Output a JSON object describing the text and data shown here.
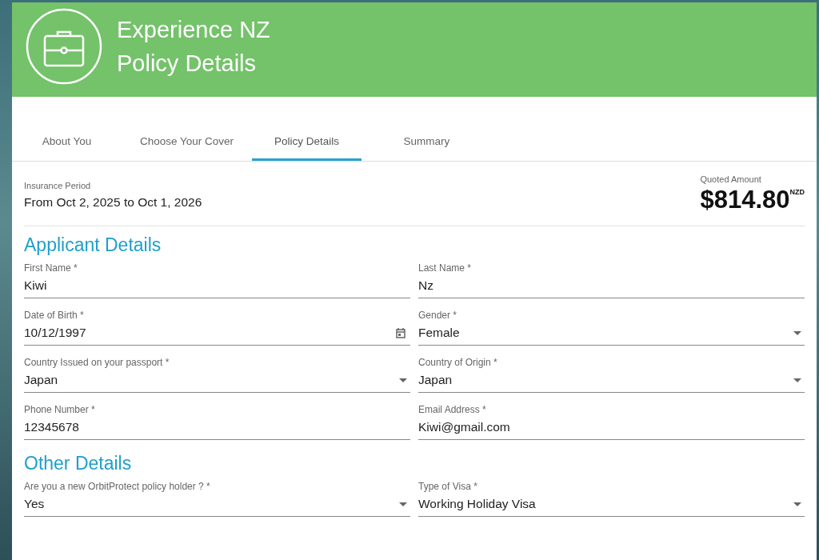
{
  "header": {
    "title_lines": [
      "Experience NZ",
      "Policy Details"
    ]
  },
  "tabs": [
    {
      "label": "About You",
      "selected": false
    },
    {
      "label": "Choose Your Cover",
      "selected": false
    },
    {
      "label": "Policy Details",
      "selected": true
    },
    {
      "label": "Summary",
      "selected": false
    }
  ],
  "insurance_period": {
    "label": "Insurance Period",
    "value": "From Oct 2, 2025 to Oct 1, 2026"
  },
  "quote": {
    "label": "Quoted Amount",
    "amount": "$814.80",
    "currency": "NZD"
  },
  "sections": [
    {
      "title": "Applicant Details",
      "fields": [
        {
          "kind": "text",
          "label": "First Name *",
          "value": "Kiwi"
        },
        {
          "kind": "text",
          "label": "Last Name *",
          "value": "Nz"
        },
        {
          "kind": "date",
          "label": "Date of Birth *",
          "value": "10/12/1997"
        },
        {
          "kind": "select",
          "label": "Gender *",
          "value": "Female"
        },
        {
          "kind": "select",
          "label": "Country Issued on your passport *",
          "value": "Japan"
        },
        {
          "kind": "select",
          "label": "Country of Origin *",
          "value": "Japan"
        },
        {
          "kind": "text",
          "label": "Phone Number *",
          "value": "12345678"
        },
        {
          "kind": "text",
          "label": "Email Address *",
          "value": "Kiwi@gmail.com"
        }
      ]
    },
    {
      "title": "Other Details",
      "fields": [
        {
          "kind": "select",
          "label": "Are you a new OrbitProtect policy holder ? *",
          "value": "Yes"
        },
        {
          "kind": "select",
          "label": "Type of Visa *",
          "value": "Working Holiday Visa"
        }
      ]
    }
  ]
}
